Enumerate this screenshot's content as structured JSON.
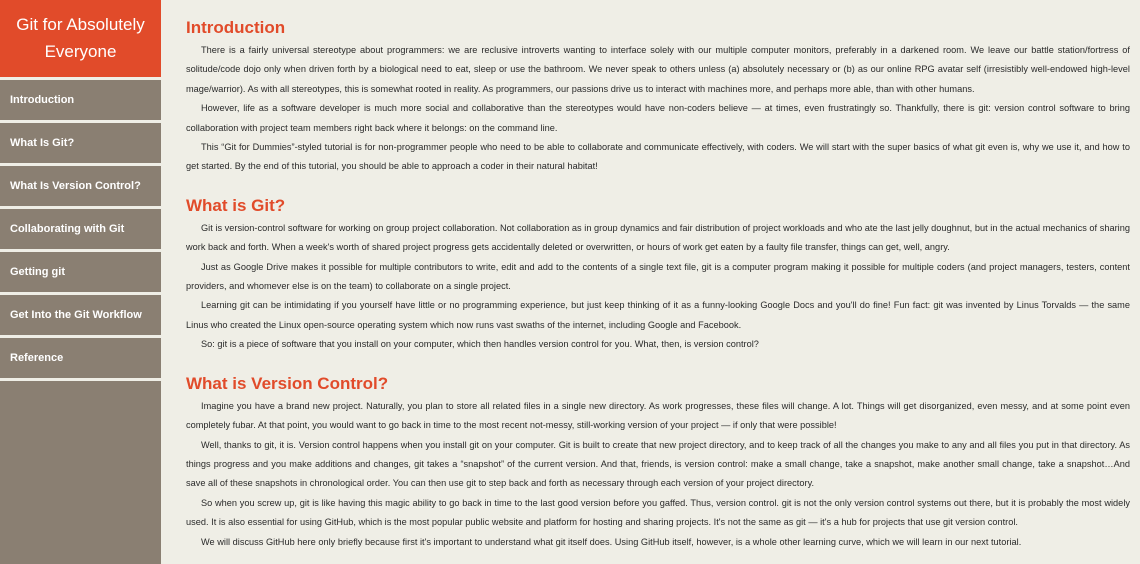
{
  "sidebar": {
    "brand_line1": "Git for Absolutely",
    "brand_line2": "Everyone",
    "items": [
      {
        "label": "Introduction"
      },
      {
        "label": "What Is Git?"
      },
      {
        "label": "What Is Version Control?"
      },
      {
        "label": "Collaborating with Git"
      },
      {
        "label": "Getting git"
      },
      {
        "label": "Get Into the Git Workflow"
      },
      {
        "label": "Reference"
      }
    ]
  },
  "colors": {
    "accent": "#e14b2a",
    "sidebar_bg": "#8a7f72",
    "page_bg": "#efeee6"
  },
  "sections": {
    "intro": {
      "title": "Introduction",
      "paragraphs": [
        "There is a fairly universal stereotype about programmers: we are reclusive introverts wanting to interface solely with our multiple computer monitors, preferably in a darkened room. We leave our battle station/fortress of solitude/code dojo only when driven forth by a biological need to eat, sleep or use the bathroom. We never speak to others unless (a) absolutely necessary or (b) as our online RPG avatar self (irresistibly well-endowed high-level mage/warrior). As with all stereotypes, this is somewhat rooted in reality. As programmers, our passions drive us to interact with machines more, and perhaps more able, than with other humans.",
        "However, life as a software developer is much more social and collaborative than the stereotypes would have non-coders believe — at times, even frustratingly so. Thankfully, there is git: version control software to bring collaboration with project team members right back where it belongs: on the command line.",
        "This “Git for Dummies”-styled tutorial is for non-programmer people who need to be able to collaborate and communicate effectively, with coders. We will start with the super basics of what git even is, why we use it, and how to get started. By the end of this tutorial, you should be able to approach a coder in their natural habitat!"
      ]
    },
    "git": {
      "title": "What is Git?",
      "paragraphs": [
        "Git is version-control software for working on group project collaboration. Not collaboration as in group dynamics and fair distribution of project workloads and who ate the last jelly doughnut, but in the actual mechanics of sharing work back and forth. When a week's worth of shared project progress gets accidentally deleted or overwritten, or hours of work get eaten by a faulty file transfer, things can get, well, angry.",
        "Just as Google Drive makes it possible for multiple contributors to write, edit and add to the contents of a single text file, git is a computer program making it possible for multiple coders (and project managers, testers, content providers, and whomever else is on the team) to collaborate on a single project.",
        "Learning git can be intimidating if you yourself have little or no programming experience, but just keep thinking of it as a funny-looking Google Docs and you'll do fine! Fun fact: git was invented by Linus Torvalds — the same Linus who created the Linux open-source operating system which now runs vast swaths of the internet, including Google and Facebook.",
        "So: git is a piece of software that you install on your computer, which then handles version control for you. What, then, is version control?"
      ]
    },
    "vc": {
      "title": "What is Version Control?",
      "paragraphs": [
        "Imagine you have a brand new project. Naturally, you plan to store all related files in a single new directory. As work progresses, these files will change. A lot. Things will get disorganized, even messy, and at some point even completely fubar. At that point, you would want to go back in time to the most recent not-messy, still-working version of your project — if only that were possible!",
        "Well, thanks to git, it is. Version control happens when you install git on your computer. Git is built to create that new project directory, and to keep track of all the changes you make to any and all files you put in that directory. As things progress and you make additions and changes, git takes a “snapshot” of the current version. And that, friends, is version control: make a small change, take a snapshot, make another small change, take a snapshot…And save all of these snapshots in chronological order. You can then use git to step back and forth as necessary through each version of your project directory.",
        "So when you screw up, git is like having this magic ability to go back in time to the last good version before you gaffed. Thus, version control. git is not the only version control systems out there, but it is probably the most widely used. It is also essential for using GitHub, which is the most popular public website and platform for hosting and sharing projects. It's not the same as git — it's a hub for projects that use git version control.",
        "We will discuss GitHub here only briefly because first it's important to understand what git itself does. Using GitHub itself, however, is a whole other learning curve, which we will learn in our next tutorial."
      ]
    }
  }
}
